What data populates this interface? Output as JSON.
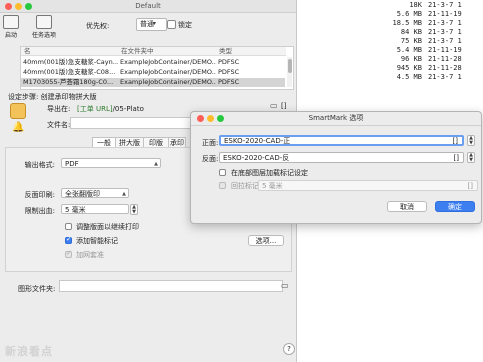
{
  "background_listing": [
    {
      "size": "18K",
      "date": "21-3-7 1"
    },
    {
      "size": "5.6 MB",
      "date": "21-11-19"
    },
    {
      "size": "18.5 MB",
      "date": "21-3-7 1"
    },
    {
      "size": "84 KB",
      "date": "21-3-7 1"
    },
    {
      "size": "75 KB",
      "date": "21-3-7 1"
    },
    {
      "size": "5.4 MB",
      "date": "21-11-19"
    },
    {
      "size": "96 KB",
      "date": "21-11-28"
    },
    {
      "size": "945 KB",
      "date": "21-11-28"
    },
    {
      "size": "4.5 MB",
      "date": "21-3-7 1"
    }
  ],
  "main_window": {
    "title": "Default",
    "toolbar": {
      "start_label": "启动",
      "task_options_label": "任务选项",
      "priority_label": "优先权:",
      "priority_value": "普通",
      "lock_label": "锁定"
    },
    "list": {
      "columns": [
        "名",
        "在文件夹中",
        "类型"
      ],
      "rows": [
        {
          "name": "40mm(001版)急支糖浆-Cayn...",
          "folder": "ExampleJobContainer/DEMO...",
          "type": "PDFSC"
        },
        {
          "name": "40mm(001版)急支糖浆-C08...",
          "folder": "ExampleJobContainer/DEMO...",
          "type": "PDFSC"
        },
        {
          "name": "M1703055-芦荟霜180g-C0...",
          "folder": "ExampleJobContainer/DEMO...",
          "type": "PDFSC"
        }
      ]
    },
    "steps_label": "设定步骤: 创建承印物拼大版",
    "output": {
      "label": "导出在:",
      "path_prefix": "[工单 URL]",
      "path_suffix": "/05-Plato",
      "bracket": "[]"
    },
    "filename_label": "文件名:",
    "tabs": [
      "一般",
      "拼大版",
      "印版",
      "承印"
    ],
    "general": {
      "output_format_label": "输出格式:",
      "output_format_value": "PDF",
      "reverse_print_label": "反面印刷:",
      "reverse_print_value": "全张翻版印",
      "limit_bleed_label": "限制出血:",
      "limit_bleed_value": "5 毫米",
      "adjust_layout_label": "调整版面以继续打印",
      "add_smart_marks_label": "添加智能标记",
      "add_dieline_label": "加网套准",
      "options_button": "选项..."
    },
    "graphics_folder_label": "图形文件夹:",
    "help": "?",
    "watermark": "新浪看点"
  },
  "dialog": {
    "title": "SmartMark 选项",
    "front_label": "正面:",
    "front_value": "ESKO-2020-CAD-正",
    "back_label": "反面:",
    "back_value": "ESKO-2020-CAD-反",
    "bracket": "[]",
    "bottom_layer_label": "在底部图层加载标记设定",
    "offset_label": "回拉标记",
    "offset_value": "5 毫米",
    "cancel": "取消",
    "ok": "确定"
  },
  "colors": {
    "accent": "#3d7ef0",
    "close": "#ff5f57",
    "minimize": "#febc2e",
    "zoom": "#28c840",
    "path_green": "#2a7a2a"
  }
}
